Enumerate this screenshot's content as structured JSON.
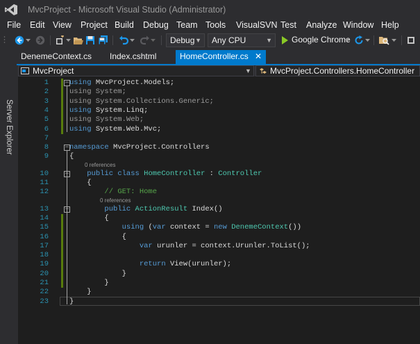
{
  "window": {
    "title": "MvcProject - Microsoft Visual Studio (Administrator)"
  },
  "menu": [
    "File",
    "Edit",
    "View",
    "Project",
    "Build",
    "Debug",
    "Team",
    "Tools",
    "VisualSVN",
    "Test",
    "Analyze",
    "Window",
    "Help"
  ],
  "toolbar": {
    "configuration": "Debug",
    "platform": "Any CPU",
    "run_target": "Google Chrome"
  },
  "side_panel": {
    "label": "Server Explorer"
  },
  "tabs": [
    {
      "label": "DenemeContext.cs",
      "active": false
    },
    {
      "label": "Index.cshtml",
      "active": false
    },
    {
      "label": "HomeController.cs",
      "active": true
    }
  ],
  "navigation": {
    "project": "MvcProject",
    "type": "MvcProject.Controllers.HomeController"
  },
  "editor": {
    "references_label": "0 references",
    "lines": [
      {
        "n": "1",
        "tokens": [
          [
            "kw",
            "using"
          ],
          [
            "pl",
            " MvcProject.Models;"
          ]
        ]
      },
      {
        "n": "2",
        "tokens": [
          [
            "gr",
            "using System;"
          ]
        ]
      },
      {
        "n": "3",
        "tokens": [
          [
            "gr",
            "using System.Collections.Generic;"
          ]
        ]
      },
      {
        "n": "4",
        "tokens": [
          [
            "kw",
            "using"
          ],
          [
            "pl",
            " System.Linq;"
          ]
        ]
      },
      {
        "n": "5",
        "tokens": [
          [
            "gr",
            "using System.Web;"
          ]
        ]
      },
      {
        "n": "6",
        "tokens": [
          [
            "kw",
            "using"
          ],
          [
            "pl",
            " System.Web.Mvc;"
          ]
        ]
      },
      {
        "n": "7",
        "tokens": []
      },
      {
        "n": "8",
        "tokens": [
          [
            "kw",
            "namespace"
          ],
          [
            "pl",
            " MvcProject.Controllers"
          ]
        ]
      },
      {
        "n": "9",
        "tokens": [
          [
            "pl",
            "{"
          ]
        ]
      },
      {
        "n": "10",
        "tokens": [
          [
            "pl",
            "    "
          ],
          [
            "kw",
            "public class"
          ],
          [
            "pl",
            " "
          ],
          [
            "ty",
            "HomeController"
          ],
          [
            "pl",
            " : "
          ],
          [
            "ty",
            "Controller"
          ]
        ]
      },
      {
        "n": "11",
        "tokens": [
          [
            "pl",
            "    {"
          ]
        ]
      },
      {
        "n": "12",
        "tokens": [
          [
            "pl",
            "        "
          ],
          [
            "cm",
            "// GET: Home"
          ]
        ]
      },
      {
        "n": "13",
        "tokens": [
          [
            "pl",
            "        "
          ],
          [
            "kw",
            "public"
          ],
          [
            "pl",
            " "
          ],
          [
            "ty",
            "ActionResult"
          ],
          [
            "pl",
            " Index()"
          ]
        ]
      },
      {
        "n": "14",
        "tokens": [
          [
            "pl",
            "        {"
          ]
        ]
      },
      {
        "n": "15",
        "tokens": [
          [
            "pl",
            "            "
          ],
          [
            "kw",
            "using"
          ],
          [
            "pl",
            " ("
          ],
          [
            "kw",
            "var"
          ],
          [
            "pl",
            " context = "
          ],
          [
            "kw",
            "new"
          ],
          [
            "pl",
            " "
          ],
          [
            "ty",
            "DenemeContext"
          ],
          [
            "pl",
            "())"
          ]
        ]
      },
      {
        "n": "16",
        "tokens": [
          [
            "pl",
            "            {"
          ]
        ]
      },
      {
        "n": "17",
        "tokens": [
          [
            "pl",
            "                "
          ],
          [
            "kw",
            "var"
          ],
          [
            "pl",
            " urunler = context.Urunler.ToList();"
          ]
        ]
      },
      {
        "n": "18",
        "tokens": []
      },
      {
        "n": "19",
        "tokens": [
          [
            "pl",
            "                "
          ],
          [
            "kw",
            "return"
          ],
          [
            "pl",
            " View(urunler);"
          ]
        ]
      },
      {
        "n": "20",
        "tokens": [
          [
            "pl",
            "            }"
          ]
        ]
      },
      {
        "n": "21",
        "tokens": [
          [
            "pl",
            "        }"
          ]
        ]
      },
      {
        "n": "22",
        "tokens": [
          [
            "pl",
            "    }"
          ]
        ]
      },
      {
        "n": "23",
        "tokens": [
          [
            "pl",
            "}"
          ]
        ]
      }
    ]
  }
}
